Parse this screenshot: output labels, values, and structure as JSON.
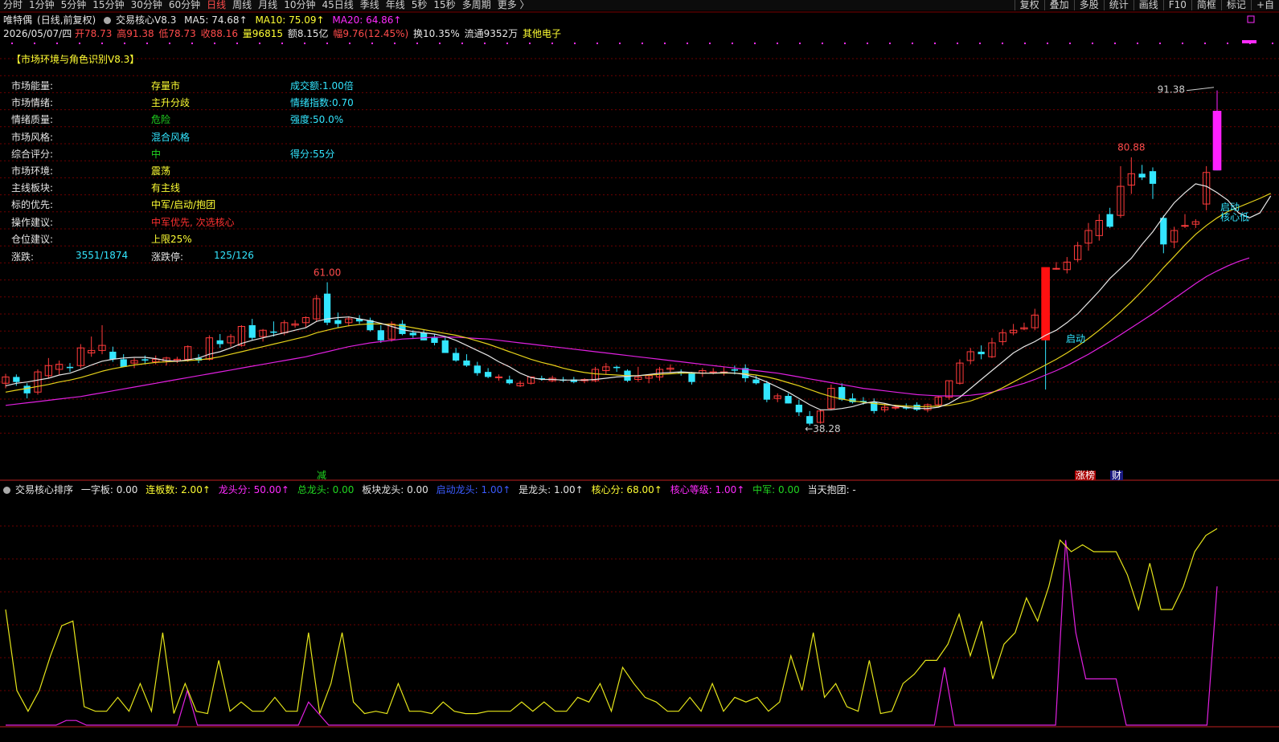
{
  "toolbar": {
    "periods": [
      "分时",
      "1分钟",
      "5分钟",
      "15分钟",
      "30分钟",
      "60分钟",
      "日线",
      "周线",
      "月线",
      "10分钟",
      "45日线",
      "季线",
      "年线",
      "5秒",
      "15秒",
      "多周期",
      "更多 〉"
    ],
    "active_period": "日线",
    "tools": [
      "复权",
      "叠加",
      "多股",
      "统计",
      "画线",
      "F10",
      "简框",
      "标记",
      "+自"
    ]
  },
  "header": {
    "stock_name": "唯特偶",
    "mode": "(日线,前复权)",
    "indicator_name": "交易核心V8.3",
    "ma5": "MA5: 74.68↑",
    "ma10": "MA10: 75.09↑",
    "ma20": "MA20: 64.86↑",
    "date": "2026/05/07/四",
    "open": "开78.73",
    "high": "高91.38",
    "low": "低78.73",
    "close": "收88.16",
    "volume": "量96815",
    "amount": "额8.15亿",
    "change": "幅9.76(12.45%)",
    "turnover": "换10.35%",
    "float": "流通9352万",
    "sector": "其他电子"
  },
  "panel": {
    "title": "【市场环境与角色识别V8.3】",
    "rows": [
      {
        "label": "市场能量:",
        "value": "存量市",
        "value_color": "yellow",
        "extra": "成交额:1.00倍"
      },
      {
        "label": "市场情绪:",
        "value": "主升分歧",
        "value_color": "yellow",
        "extra": "情绪指数:0.70"
      },
      {
        "label": "情绪质量:",
        "value": "危险",
        "value_color": "green",
        "extra": "强度:50.0%"
      },
      {
        "label": "市场风格:",
        "value": "混合风格",
        "value_color": "cyan",
        "extra": ""
      },
      {
        "label": "综合评分:",
        "value": "中",
        "value_color": "green",
        "extra": "得分:55分"
      },
      {
        "label": "市场环境:",
        "value": "震荡",
        "value_color": "yellow",
        "extra": ""
      },
      {
        "label": "主线板块:",
        "value": "有主线",
        "value_color": "yellow",
        "extra": ""
      },
      {
        "label": "标的优先:",
        "value": "中军/启动/抱团",
        "value_color": "yellow",
        "extra": ""
      },
      {
        "label": "操作建议:",
        "value": "中军优先, 次选核心",
        "value_color": "red",
        "extra": ""
      },
      {
        "label": "仓位建议:",
        "value": "上限25%",
        "value_color": "yellow",
        "extra": ""
      }
    ],
    "updown_label": "涨跌:",
    "updown_value": "3551/1874",
    "limit_label": "涨跌停:",
    "limit_value": "125/126"
  },
  "chart_data": {
    "type": "candlestick",
    "ylim": [
      36,
      93
    ],
    "annotations": {
      "peak1": "61.00",
      "low": "←38.28",
      "peak2": "80.88",
      "peak3": "91.38",
      "qidong1": "启动",
      "qidong2": "启动",
      "hexindi": "核心低",
      "marker_jian": "减",
      "marker_zhangting": "涨榜",
      "marker_cai": "财"
    },
    "candles": [
      [
        45.0,
        46.5,
        44.2,
        46.0
      ],
      [
        46.0,
        46.4,
        44.6,
        45.2
      ],
      [
        44.6,
        45.0,
        42.6,
        43.4
      ],
      [
        43.6,
        47.2,
        43.2,
        46.8
      ],
      [
        46.2,
        49.0,
        45.8,
        47.8
      ],
      [
        47.2,
        48.6,
        46.4,
        48.0
      ],
      [
        47.6,
        48.2,
        46.8,
        47.4
      ],
      [
        47.8,
        51.2,
        47.4,
        50.6
      ],
      [
        49.8,
        52.4,
        49.2,
        50.2
      ],
      [
        50.2,
        54.2,
        49.6,
        51.0
      ],
      [
        50.0,
        50.8,
        48.4,
        48.8
      ],
      [
        48.8,
        49.6,
        47.6,
        47.6
      ],
      [
        48.2,
        49.0,
        47.4,
        48.6
      ],
      [
        48.8,
        49.4,
        48.0,
        48.6
      ],
      [
        48.4,
        49.4,
        48.0,
        48.8
      ],
      [
        48.4,
        49.2,
        47.8,
        49.0
      ],
      [
        48.6,
        49.2,
        48.2,
        48.8
      ],
      [
        48.8,
        51.0,
        48.4,
        50.8
      ],
      [
        49.0,
        49.6,
        48.2,
        48.6
      ],
      [
        48.8,
        52.6,
        48.6,
        52.2
      ],
      [
        51.8,
        52.8,
        50.6,
        51.2
      ],
      [
        51.4,
        52.8,
        50.8,
        52.4
      ],
      [
        51.0,
        54.2,
        50.8,
        54.0
      ],
      [
        54.2,
        55.2,
        51.8,
        52.2
      ],
      [
        52.4,
        53.6,
        51.6,
        53.4
      ],
      [
        53.2,
        54.8,
        52.4,
        53.0
      ],
      [
        53.0,
        55.0,
        52.6,
        54.6
      ],
      [
        54.2,
        55.0,
        53.8,
        54.4
      ],
      [
        54.6,
        55.6,
        53.8,
        55.4
      ],
      [
        55.2,
        59.0,
        54.8,
        58.4
      ],
      [
        59.2,
        61.0,
        54.2,
        54.6
      ],
      [
        55.0,
        56.2,
        53.8,
        54.4
      ],
      [
        54.6,
        55.6,
        54.0,
        55.2
      ],
      [
        55.2,
        55.8,
        54.4,
        54.8
      ],
      [
        55.0,
        55.4,
        53.2,
        53.4
      ],
      [
        53.4,
        54.2,
        51.4,
        51.8
      ],
      [
        52.0,
        54.8,
        51.6,
        54.4
      ],
      [
        54.4,
        55.0,
        52.6,
        52.8
      ],
      [
        53.0,
        53.4,
        52.2,
        52.6
      ],
      [
        53.0,
        53.4,
        51.8,
        51.8
      ],
      [
        52.2,
        52.8,
        51.0,
        51.4
      ],
      [
        51.8,
        52.2,
        49.8,
        49.8
      ],
      [
        49.8,
        50.6,
        48.4,
        48.6
      ],
      [
        48.6,
        49.6,
        47.6,
        47.8
      ],
      [
        47.8,
        48.4,
        46.2,
        46.6
      ],
      [
        46.8,
        47.4,
        45.8,
        46.0
      ],
      [
        46.0,
        46.4,
        45.4,
        46.0
      ],
      [
        45.6,
        46.2,
        44.8,
        45.0
      ],
      [
        44.6,
        45.4,
        44.4,
        45.0
      ],
      [
        45.0,
        46.0,
        44.8,
        46.0
      ],
      [
        45.8,
        46.2,
        45.4,
        45.6
      ],
      [
        45.4,
        46.2,
        45.2,
        45.8
      ],
      [
        45.6,
        46.0,
        45.2,
        45.4
      ],
      [
        45.6,
        46.0,
        45.0,
        45.2
      ],
      [
        45.4,
        45.8,
        45.0,
        45.6
      ],
      [
        45.4,
        47.6,
        45.2,
        47.2
      ],
      [
        47.0,
        48.2,
        46.4,
        47.6
      ],
      [
        47.6,
        47.8,
        46.8,
        47.4
      ],
      [
        47.0,
        47.2,
        45.2,
        45.4
      ],
      [
        45.6,
        47.6,
        45.2,
        46.0
      ],
      [
        45.8,
        46.4,
        45.0,
        46.2
      ],
      [
        46.0,
        47.6,
        45.4,
        47.2
      ],
      [
        47.2,
        48.0,
        46.6,
        47.4
      ],
      [
        46.8,
        47.2,
        46.2,
        46.6
      ],
      [
        46.6,
        46.8,
        44.8,
        45.2
      ],
      [
        46.6,
        47.4,
        46.0,
        47.0
      ],
      [
        46.8,
        47.4,
        46.4,
        46.8
      ],
      [
        46.8,
        47.6,
        46.2,
        46.8
      ],
      [
        47.2,
        47.8,
        46.4,
        47.0
      ],
      [
        47.4,
        48.0,
        45.2,
        45.8
      ],
      [
        45.6,
        46.2,
        44.8,
        45.0
      ],
      [
        45.0,
        45.4,
        42.0,
        42.4
      ],
      [
        42.6,
        43.4,
        42.0,
        43.0
      ],
      [
        43.0,
        43.4,
        41.8,
        41.8
      ],
      [
        41.6,
        42.4,
        39.8,
        40.4
      ],
      [
        39.8,
        40.6,
        38.3,
        38.6
      ],
      [
        38.8,
        40.8,
        38.6,
        40.6
      ],
      [
        41.0,
        44.8,
        40.8,
        44.2
      ],
      [
        44.4,
        45.0,
        42.2,
        42.4
      ],
      [
        42.6,
        43.4,
        41.8,
        42.0
      ],
      [
        42.2,
        42.8,
        41.6,
        42.0
      ],
      [
        42.0,
        42.6,
        40.2,
        40.6
      ],
      [
        40.8,
        41.8,
        40.4,
        41.2
      ],
      [
        41.2,
        41.6,
        40.8,
        41.2
      ],
      [
        41.2,
        41.8,
        40.8,
        41.0
      ],
      [
        41.6,
        42.0,
        40.6,
        40.8
      ],
      [
        40.8,
        41.8,
        40.4,
        41.6
      ],
      [
        41.6,
        43.0,
        41.4,
        42.8
      ],
      [
        42.8,
        45.4,
        42.4,
        45.4
      ],
      [
        45.0,
        48.8,
        44.8,
        48.2
      ],
      [
        48.6,
        50.6,
        48.0,
        50.0
      ],
      [
        50.0,
        51.0,
        48.8,
        49.6
      ],
      [
        49.2,
        52.2,
        49.0,
        51.4
      ],
      [
        51.6,
        53.6,
        51.0,
        53.0
      ],
      [
        53.0,
        54.4,
        52.6,
        53.4
      ],
      [
        53.6,
        54.6,
        53.4,
        53.8
      ],
      [
        53.8,
        56.8,
        53.4,
        55.8
      ],
      [
        56.0,
        57.0,
        44.0,
        54.6
      ],
      [
        63.2,
        64.2,
        63.0,
        63.2
      ],
      [
        63.0,
        65.0,
        62.4,
        64.2
      ],
      [
        64.6,
        67.4,
        64.2,
        66.8
      ],
      [
        67.2,
        70.4,
        66.0,
        69.2
      ],
      [
        68.4,
        71.8,
        67.6,
        70.8
      ],
      [
        71.8,
        72.8,
        69.6,
        69.8
      ],
      [
        71.6,
        79.4,
        71.2,
        76.2
      ],
      [
        76.4,
        80.8,
        75.0,
        78.2
      ],
      [
        78.2,
        79.6,
        77.2,
        77.6
      ],
      [
        78.6,
        79.2,
        74.2,
        76.6
      ],
      [
        71.2,
        71.6,
        65.6,
        67.0
      ],
      [
        67.4,
        69.8,
        66.4,
        69.2
      ],
      [
        70.0,
        71.8,
        69.6,
        70.0
      ],
      [
        70.2,
        71.0,
        69.6,
        70.6
      ],
      [
        73.4,
        79.4,
        72.4,
        78.4
      ],
      [
        88.16,
        91.38,
        78.73,
        78.73
      ]
    ],
    "ma5": [
      44.6,
      45.0,
      45.2,
      45.5,
      45.8,
      46.3,
      46.6,
      47.2,
      47.9,
      48.5,
      48.8,
      49.0,
      49.1,
      49.1,
      48.9,
      48.6,
      48.5,
      48.7,
      49.0,
      49.6,
      50.0,
      50.6,
      51.3,
      51.8,
      52.2,
      52.6,
      53.0,
      53.4,
      53.8,
      54.8,
      55.2,
      55.4,
      55.5,
      55.2,
      54.9,
      54.5,
      54.0,
      53.5,
      53.2,
      53.0,
      52.8,
      52.4,
      51.8,
      51.0,
      50.2,
      49.4,
      48.4,
      47.6,
      46.6,
      45.9,
      45.6,
      45.6,
      45.5,
      45.5,
      45.5,
      45.6,
      45.8,
      46.0,
      46.1,
      46.2,
      46.4,
      46.6,
      46.7,
      46.8,
      46.7,
      46.6,
      46.6,
      46.7,
      46.6,
      46.4,
      45.9,
      45.2,
      44.4,
      43.6,
      42.6,
      41.6,
      40.8,
      40.8,
      41.0,
      41.3,
      41.8,
      42.1,
      41.8,
      41.4,
      41.2,
      41.0,
      41.0,
      41.2,
      41.8,
      42.8,
      44.2,
      45.6,
      47.0,
      48.4,
      49.8,
      50.8,
      51.6,
      52.6,
      53.4,
      54.6,
      56.0,
      57.8,
      59.6,
      61.6,
      63.2,
      64.8,
      67.0,
      69.0,
      71.4,
      73.6,
      75.2,
      76.6,
      76.2,
      75.2,
      74.0,
      72.0,
      71.2,
      72.0,
      74.68
    ],
    "ma10": [
      43.6,
      43.9,
      44.2,
      44.5,
      44.8,
      45.2,
      45.5,
      45.9,
      46.4,
      46.9,
      47.3,
      47.6,
      47.9,
      48.1,
      48.3,
      48.4,
      48.5,
      48.6,
      48.7,
      48.9,
      49.2,
      49.6,
      50.0,
      50.4,
      50.8,
      51.2,
      51.6,
      52.0,
      52.4,
      53.0,
      53.4,
      53.8,
      54.1,
      54.3,
      54.4,
      54.4,
      54.3,
      54.1,
      53.8,
      53.5,
      53.2,
      52.9,
      52.6,
      52.2,
      51.7,
      51.2,
      50.6,
      50.0,
      49.4,
      48.8,
      48.3,
      47.9,
      47.4,
      47.0,
      46.7,
      46.5,
      46.4,
      46.3,
      46.2,
      46.2,
      46.3,
      46.4,
      46.5,
      46.6,
      46.6,
      46.6,
      46.6,
      46.6,
      46.6,
      46.5,
      46.3,
      46.0,
      45.6,
      45.1,
      44.6,
      44.0,
      43.4,
      42.9,
      42.5,
      42.2,
      42.0,
      41.8,
      41.6,
      41.5,
      41.4,
      41.3,
      41.3,
      41.4,
      41.5,
      41.8,
      42.2,
      42.8,
      43.5,
      44.3,
      45.2,
      46.1,
      47.0,
      47.9,
      48.8,
      49.8,
      50.9,
      52.1,
      53.4,
      54.8,
      56.3,
      57.9,
      59.6,
      61.4,
      63.3,
      65.1,
      66.9,
      68.6,
      70.0,
      71.2,
      72.2,
      72.9,
      73.6,
      74.3,
      75.09
    ],
    "ma20": [
      41.5,
      41.7,
      41.9,
      42.1,
      42.3,
      42.5,
      42.7,
      42.9,
      43.2,
      43.5,
      43.8,
      44.1,
      44.4,
      44.7,
      45.0,
      45.3,
      45.6,
      45.9,
      46.2,
      46.5,
      46.8,
      47.1,
      47.4,
      47.7,
      48.0,
      48.3,
      48.6,
      48.9,
      49.2,
      49.6,
      50.0,
      50.4,
      50.8,
      51.1,
      51.4,
      51.6,
      51.8,
      52.0,
      52.1,
      52.2,
      52.3,
      52.3,
      52.3,
      52.2,
      52.1,
      52.0,
      51.8,
      51.6,
      51.4,
      51.2,
      51.0,
      50.8,
      50.6,
      50.4,
      50.2,
      50.0,
      49.8,
      49.6,
      49.4,
      49.2,
      49.0,
      48.8,
      48.6,
      48.4,
      48.2,
      48.0,
      47.8,
      47.6,
      47.4,
      47.2,
      47.0,
      46.8,
      46.6,
      46.3,
      46.0,
      45.7,
      45.4,
      45.1,
      44.8,
      44.5,
      44.2,
      44.0,
      43.8,
      43.6,
      43.4,
      43.2,
      43.1,
      43.0,
      43.0,
      43.0,
      43.1,
      43.3,
      43.6,
      44.0,
      44.5,
      45.0,
      45.6,
      46.3,
      47.0,
      47.8,
      48.7,
      49.6,
      50.6,
      51.6,
      52.7,
      53.8,
      54.9,
      56.0,
      57.2,
      58.4,
      59.6,
      60.8,
      61.9,
      62.8,
      63.6,
      64.3,
      64.86
    ]
  },
  "sub_indicator": {
    "name": "交易核心排序",
    "yizi": "一字板: 0.00",
    "lianban": "连板数: 2.00↑",
    "longtou": "龙头分: 50.00↑",
    "zonglongtou": "总龙头: 0.00",
    "bankuai": "板块龙头: 0.00",
    "qidong": "启动龙头: 1.00↑",
    "shilongtou": "是龙头: 1.00↑",
    "hexinfen": "核心分: 68.00↑",
    "hexindengji": "核心等级: 1.00↑",
    "zhongjun": "中军: 0.00",
    "baotuan": "当天抱团: -",
    "ylim": [
      0,
      100
    ],
    "yellow_line": [
      50,
      15,
      6,
      15,
      30,
      43,
      45,
      8,
      6,
      6,
      12,
      6,
      18,
      6,
      40,
      5,
      18,
      6,
      5,
      28,
      6,
      10,
      6,
      6,
      12,
      6,
      6,
      40,
      5,
      18,
      40,
      10,
      5,
      6,
      5,
      18,
      6,
      6,
      5,
      10,
      6,
      5,
      5,
      6,
      6,
      6,
      10,
      6,
      10,
      6,
      6,
      12,
      10,
      18,
      6,
      25,
      18,
      12,
      10,
      6,
      6,
      12,
      6,
      18,
      6,
      12,
      10,
      12,
      6,
      10,
      30,
      15,
      40,
      12,
      18,
      8,
      6,
      28,
      5,
      6,
      18,
      22,
      28,
      28,
      35,
      48,
      30,
      45,
      20,
      35,
      40,
      55,
      45,
      60,
      80,
      75,
      78,
      75,
      75,
      75,
      65,
      50,
      70,
      50,
      50,
      60,
      75,
      82,
      85
    ],
    "magenta_line": [
      0,
      0,
      0,
      0,
      0,
      0,
      2,
      2,
      0,
      0,
      0,
      0,
      0,
      0,
      0,
      0,
      0,
      0,
      15,
      0,
      0,
      0,
      0,
      0,
      0,
      0,
      0,
      0,
      0,
      0,
      10,
      5,
      0,
      0,
      0,
      0,
      0,
      0,
      0,
      0,
      0,
      0,
      0,
      0,
      0,
      0,
      0,
      0,
      0,
      0,
      0,
      0,
      0,
      0,
      0,
      0,
      0,
      0,
      0,
      0,
      0,
      0,
      0,
      0,
      0,
      0,
      0,
      0,
      0,
      0,
      0,
      0,
      0,
      0,
      0,
      0,
      0,
      0,
      0,
      0,
      0,
      0,
      0,
      0,
      0,
      0,
      0,
      0,
      0,
      0,
      0,
      0,
      0,
      25,
      0,
      0,
      0,
      0,
      0,
      0,
      0,
      0,
      0,
      0,
      0,
      80,
      40,
      20,
      20,
      20,
      20,
      0,
      0,
      0,
      0,
      0,
      0,
      0,
      0,
      0,
      60
    ]
  },
  "colors": {
    "up": "#ff3b3b",
    "down": "#33e6ff",
    "ma5": "#e6e6e6",
    "ma10": "#e6d21a",
    "ma20": "#e020e0",
    "grid": "#6e0000"
  }
}
